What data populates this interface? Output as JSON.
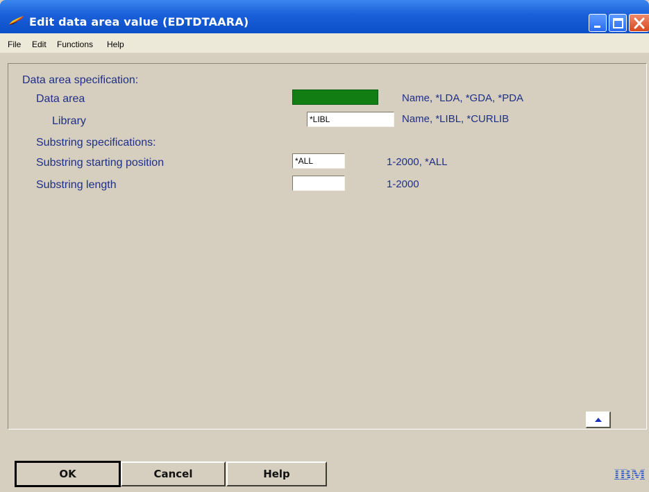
{
  "window": {
    "title": "Edit data area value (EDTDTAARA)"
  },
  "menu": [
    "File",
    "Edit",
    "Functions",
    "Help"
  ],
  "form": {
    "section_heading": "Data area specification:",
    "data_area": {
      "label": "Data area",
      "value": "",
      "hint": "Name, *LDA, *GDA, *PDA"
    },
    "library": {
      "label": "Library",
      "value": "*LIBL",
      "hint": "Name, *LIBL, *CURLIB"
    },
    "substring_heading": "Substring specifications:",
    "substring_start": {
      "label": "Substring starting position",
      "value": "*ALL",
      "hint": "1-2000, *ALL"
    },
    "substring_length": {
      "label": "Substring length",
      "value": "",
      "hint": "1-2000"
    }
  },
  "buttons": {
    "ok": "OK",
    "cancel": "Cancel",
    "help": "Help"
  },
  "brand": "IBM",
  "colors": {
    "title_bar": "#1a5fd8",
    "data_area_field": "#127d12",
    "label_text": "#1f2f86",
    "panel_bg": "#d6cfbf"
  }
}
